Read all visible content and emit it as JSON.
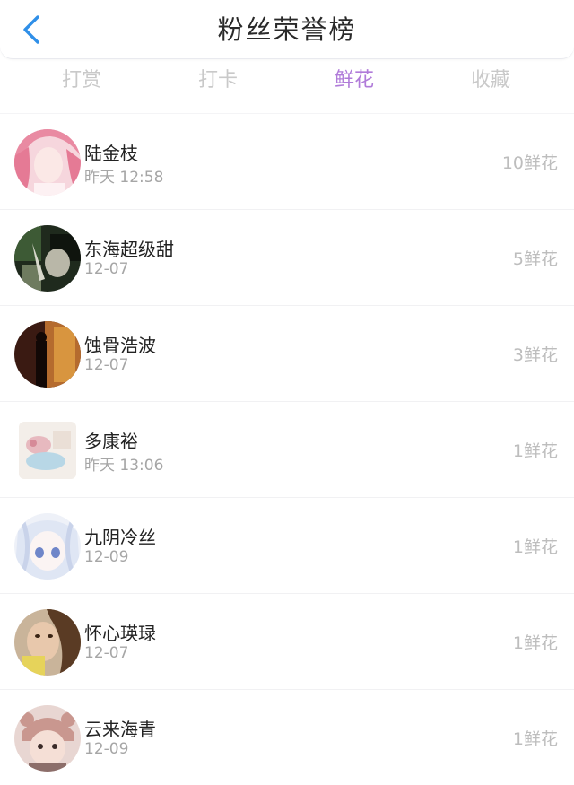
{
  "header": {
    "title": "粉丝荣誉榜",
    "back_icon": "chevron-left-icon",
    "accent_color": "#2f8fe8"
  },
  "tabs": [
    {
      "label": "打赏",
      "active": false
    },
    {
      "label": "打卡",
      "active": false
    },
    {
      "label": "鲜花",
      "active": true
    },
    {
      "label": "收藏",
      "active": false
    }
  ],
  "active_tab_color": "#b07bd9",
  "list": [
    {
      "name": "陆金枝",
      "time": "昨天 12:58",
      "amount": "10鲜花"
    },
    {
      "name": "东海超级甜",
      "time": "12-07",
      "amount": "5鲜花"
    },
    {
      "name": "蚀骨浩波",
      "time": "12-07",
      "amount": "3鲜花"
    },
    {
      "name": "多康裕",
      "time": "昨天 13:06",
      "amount": "1鲜花"
    },
    {
      "name": "九阴冷丝",
      "time": "12-09",
      "amount": "1鲜花"
    },
    {
      "name": "怀心瑛琭",
      "time": "12-07",
      "amount": "1鲜花"
    },
    {
      "name": "云来海青",
      "time": "12-09",
      "amount": "1鲜花"
    }
  ]
}
